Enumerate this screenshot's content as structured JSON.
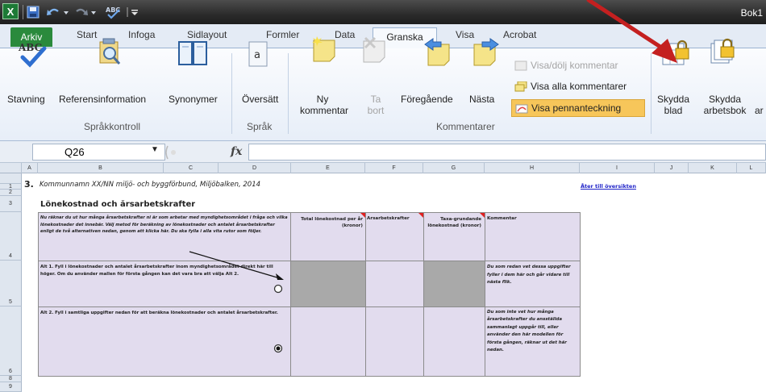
{
  "window": {
    "title_partial": "Bok1"
  },
  "tabs": {
    "file": "Arkiv",
    "items": [
      "Start",
      "Infoga",
      "Sidlayout",
      "Formler",
      "Data",
      "Granska",
      "Visa",
      "Acrobat"
    ],
    "active": "Granska"
  },
  "ribbon": {
    "proofing": {
      "label": "Språkkontroll",
      "spelling_icon_text": "ABC",
      "spelling": "Stavning",
      "research": "Referensinformation",
      "thesaurus": "Synonymer"
    },
    "language": {
      "label": "Språk",
      "translate": "Översätt",
      "translate_icon_text": "a"
    },
    "comments": {
      "label": "Kommentarer",
      "new_comment_1": "Ny",
      "new_comment_2": "kommentar",
      "delete_1": "Ta",
      "delete_2": "bort",
      "previous": "Föregående",
      "next": "Nästa",
      "show_hide": "Visa/dölj kommentar",
      "show_all": "Visa alla kommentarer",
      "show_ink": "Visa pennanteckning"
    },
    "changes": {
      "protect_sheet_1": "Skydda",
      "protect_sheet_2": "blad",
      "protect_workbook_1": "Skydda",
      "protect_workbook_2": "arbetsbok",
      "partial": "ar"
    }
  },
  "formula_bar": {
    "name_box": "Q26",
    "fx": "fx",
    "formula": ""
  },
  "columns": [
    "A",
    "B",
    "C",
    "D",
    "E",
    "F",
    "G",
    "H",
    "I",
    "J",
    "K",
    "L"
  ],
  "rows": [
    "1",
    "2",
    "3",
    "4",
    "5",
    "6",
    "8",
    "9"
  ],
  "sheet": {
    "row1_number": "3.",
    "row1_title": "Kommunnamn XX/NN miljö- och byggförbund, Miljöbalken, 2014",
    "link": "Åter till översikten",
    "heading": "Lönekostnad och årsarbetskrafter",
    "intro": "Nu räknar du ut hur många årsarbetskrafter ni är som arbetar med myndighetsområdet i fråga och vilka lönekostnader det innebär. Välj metod för beräkning av lönekostnader och antalet årsarbetskrafter enligt de två alternativen nedan, genom att klicka här. Du ska fylla i alla vita rutor som följer.",
    "col_total": "Total lönekostnad per år (kronor)",
    "col_fte": "Årsarbetskrafter",
    "col_tax": "Taxa-grundande lönekostnad (kronor)",
    "col_comment": "Kommentar",
    "alt1": "Alt 1. Fyll i lönekostnader och antalet årsarbetskrafter inom myndighetsområdet direkt här till höger. Om du använder mallen för första gången kan det vara bra att välja Alt 2.",
    "alt1_comment": "Du som redan vet dessa uppgifter fyller i dem här och går vidare till nästa flik.",
    "alt2": "Alt 2. Fyll i samtliga uppgifter nedan för att beräkna lönekostnader och antalet årsarbetskrafter.",
    "alt2_comment": "Du som inte vet hur många årsarbetskrafter du ansställda sammanlagt uppgår till, eller använder den här modellen för första gången, räknar ut det här nedan."
  },
  "colors": {
    "arkiv_tab": "#2a8a3c",
    "cell_lilac": "#e2dcee",
    "cell_gray": "#a9a9a9",
    "highlight_button": "#f7c65a",
    "red_arrow": "#c42020",
    "comment_marker": "#e02020",
    "link": "#1f23c8"
  },
  "icons": [
    "excel-logo-icon",
    "save-icon",
    "undo-icon",
    "redo-icon",
    "spellcheck-icon",
    "lock-icon"
  ]
}
